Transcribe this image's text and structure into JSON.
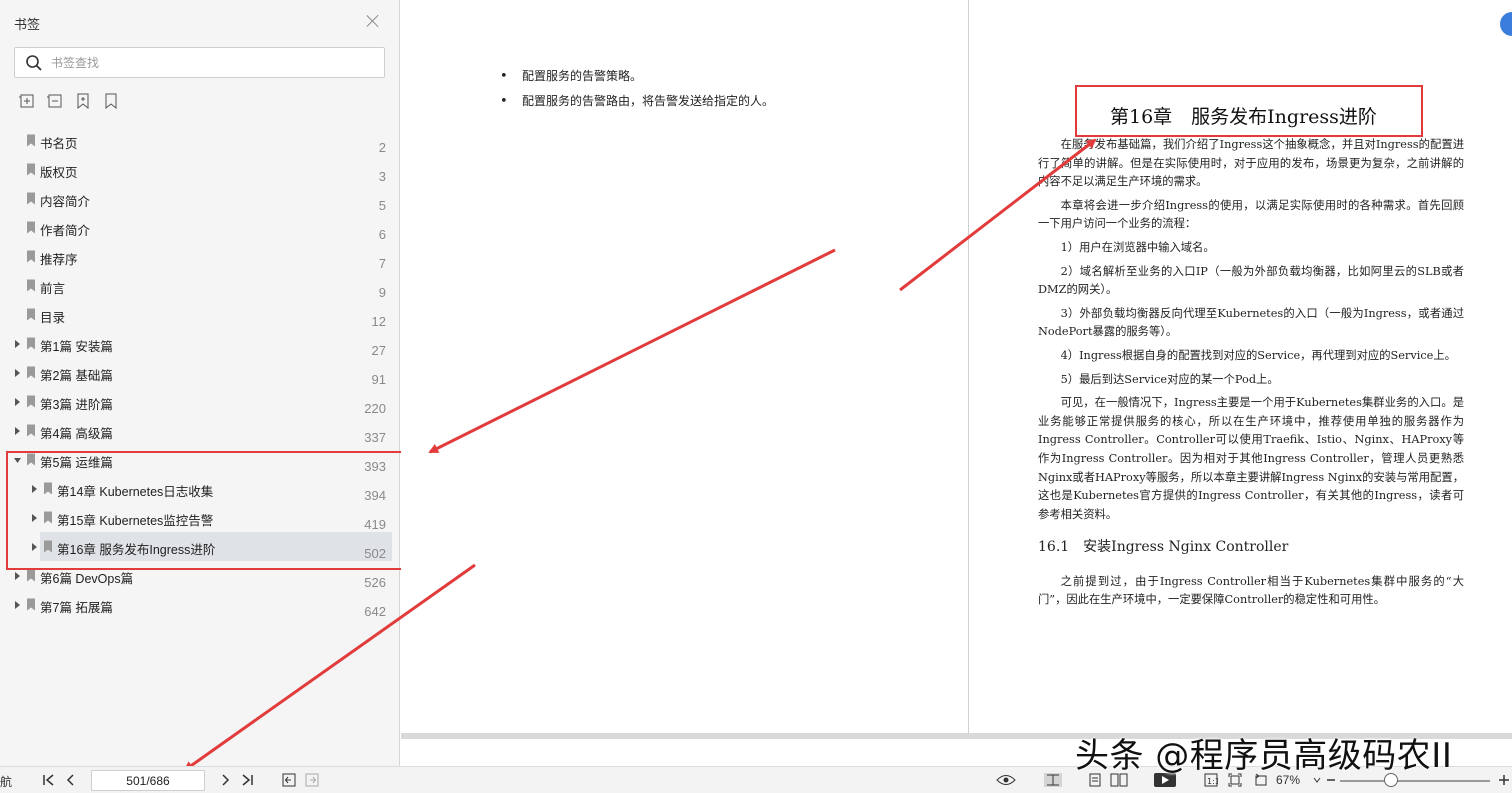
{
  "sidebar": {
    "title": "书签",
    "search_placeholder": "书签查找",
    "items": [
      {
        "label": "书名页",
        "page": "2",
        "level": 0,
        "expandable": false
      },
      {
        "label": "版权页",
        "page": "3",
        "level": 0,
        "expandable": false
      },
      {
        "label": "内容简介",
        "page": "5",
        "level": 0,
        "expandable": false
      },
      {
        "label": "作者简介",
        "page": "6",
        "level": 0,
        "expandable": false
      },
      {
        "label": "推荐序",
        "page": "7",
        "level": 0,
        "expandable": false
      },
      {
        "label": "前言",
        "page": "9",
        "level": 0,
        "expandable": false
      },
      {
        "label": "目录",
        "page": "12",
        "level": 0,
        "expandable": false
      },
      {
        "label": "第1篇 安装篇",
        "page": "27",
        "level": 0,
        "expandable": true
      },
      {
        "label": "第2篇 基础篇",
        "page": "91",
        "level": 0,
        "expandable": true
      },
      {
        "label": "第3篇 进阶篇",
        "page": "220",
        "level": 0,
        "expandable": true
      },
      {
        "label": "第4篇 高级篇",
        "page": "337",
        "level": 0,
        "expandable": true
      },
      {
        "label": "第5篇 运维篇",
        "page": "393",
        "level": 0,
        "expandable": true,
        "expanded": true
      },
      {
        "label": "第14章 Kubernetes日志收集",
        "page": "394",
        "level": 1,
        "expandable": true
      },
      {
        "label": "第15章 Kubernetes监控告警",
        "page": "419",
        "level": 1,
        "expandable": true
      },
      {
        "label": "第16章 服务发布Ingress进阶",
        "page": "502",
        "level": 1,
        "expandable": true,
        "selected": true
      },
      {
        "label": "第6篇 DevOps篇",
        "page": "526",
        "level": 0,
        "expandable": true
      },
      {
        "label": "第7篇 拓展篇",
        "page": "642",
        "level": 0,
        "expandable": true
      }
    ]
  },
  "left_page": {
    "bullets": [
      "配置服务的告警策略。",
      "配置服务的告警路由，将告警发送给指定的人。"
    ]
  },
  "right_page": {
    "chapter_title": "第16章　服务发布Ingress进阶",
    "paragraphs": [
      "在服务发布基础篇，我们介绍了Ingress这个抽象概念，并且对Ingress的配置进行了简单的讲解。但是在实际使用时，对于应用的发布，场景更为复杂，之前讲解的内容不足以满足生产环境的需求。",
      "本章将会进一步介绍Ingress的使用，以满足实际使用时的各种需求。首先回顾一下用户访问一个业务的流程：",
      "1）用户在浏览器中输入域名。",
      "2）域名解析至业务的入口IP（一般为外部负载均衡器，比如阿里云的SLB或者DMZ的网关）。",
      "3）外部负载均衡器反向代理至Kubernetes的入口（一般为Ingress，或者通过NodePort暴露的服务等）。",
      "4）Ingress根据自身的配置找到对应的Service，再代理到对应的Service上。",
      "5）最后到达Service对应的某一个Pod上。",
      "可见，在一般情况下，Ingress主要是一个用于Kubernetes集群业务的入口。是业务能够正常提供服务的核心，所以在生产环境中，推荐使用单独的服务器作为Ingress Controller。Controller可以使用Traefik、Istio、Nginx、HAProxy等作为Ingress Controller。因为相对于其他Ingress Controller，管理人员更熟悉Nginx或者HAProxy等服务，所以本章主要讲解Ingress Nginx的安装与常用配置，这也是Kubernetes官方提供的Ingress Controller，有关其他的Ingress，读者可参考相关资料。"
    ],
    "section_heading": "16.1　安装Ingress Nginx Controller",
    "section_paragraph": "之前提到过，由于Ingress Controller相当于Kubernetes集群中服务的“大门”，因此在生产环境中，一定要保障Controller的稳定性和可用性。"
  },
  "statusbar": {
    "nav_label": "航",
    "page_value": "501/686",
    "zoom": "67%"
  },
  "watermark": "头条 @程序员高级码农II",
  "colors": {
    "annotation_red": "#e23b3b",
    "selected_row": "#dfe2e6",
    "sidebar_bg": "#f5f5f5"
  }
}
